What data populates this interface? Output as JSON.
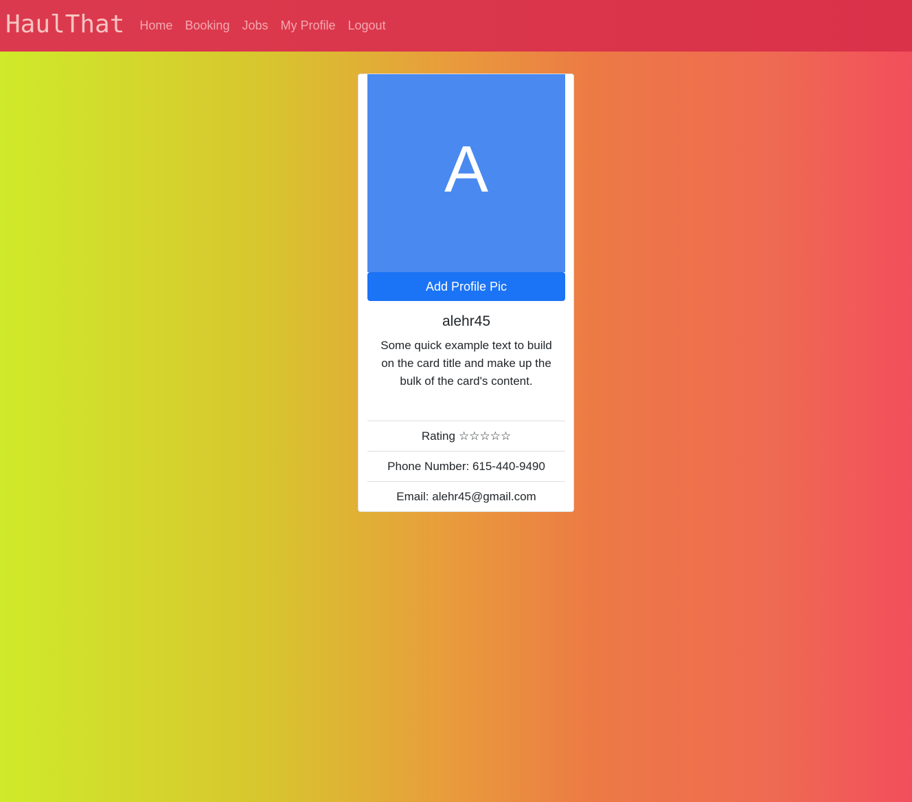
{
  "navbar": {
    "brand": "HaulThat",
    "links": [
      "Home",
      "Booking",
      "Jobs",
      "My Profile",
      "Logout"
    ]
  },
  "profile": {
    "avatar_letter": "A",
    "add_pic_label": "Add Profile Pic",
    "username": "alehr45",
    "description": "Some quick example text to build on the card title and make up the bulk of the card's content.",
    "rating_label": "Rating",
    "rating_stars": "☆☆☆☆☆",
    "phone": "Phone Number: 615-440-9490",
    "email": "Email: alehr45@gmail.com"
  },
  "colors": {
    "navbar": "#db3a4e",
    "avatar_bg": "#4a89f0",
    "button_bg": "#1b73f5",
    "brand_text": "#f6c3c2",
    "nav_link": "#f4a8b0"
  }
}
